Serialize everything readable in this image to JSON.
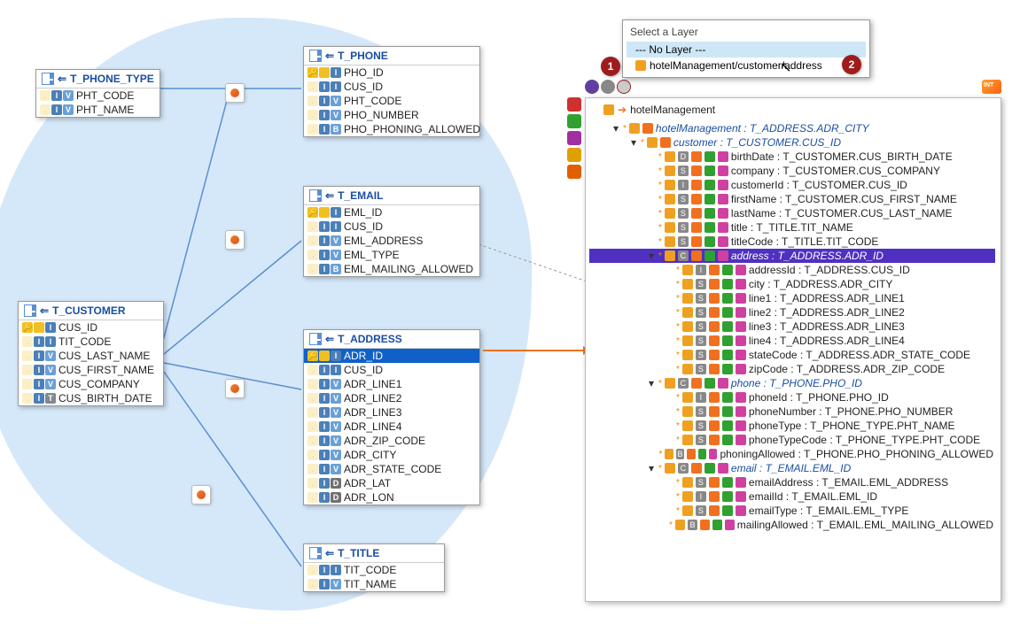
{
  "popup": {
    "title": "Select a Layer",
    "options": [
      "--- No Layer ---",
      "hotelManagement/customer/address"
    ],
    "selected_index": 0
  },
  "callouts": [
    "1",
    "2"
  ],
  "tables": {
    "phone_type": {
      "name": "T_PHONE_TYPE",
      "cols": [
        {
          "t": [
            "i",
            "v"
          ],
          "n": "PHT_CODE"
        },
        {
          "t": [
            "i",
            "v"
          ],
          "n": "PHT_NAME"
        }
      ]
    },
    "phone": {
      "name": "T_PHONE",
      "cols": [
        {
          "t": [
            "k",
            "i"
          ],
          "n": "PHO_ID"
        },
        {
          "t": [
            "i",
            "i"
          ],
          "n": "CUS_ID"
        },
        {
          "t": [
            "i",
            "v"
          ],
          "n": "PHT_CODE"
        },
        {
          "t": [
            "i",
            "v"
          ],
          "n": "PHO_NUMBER"
        },
        {
          "t": [
            "i",
            "b"
          ],
          "n": "PHO_PHONING_ALLOWED"
        }
      ]
    },
    "email": {
      "name": "T_EMAIL",
      "cols": [
        {
          "t": [
            "k",
            "i"
          ],
          "n": "EML_ID"
        },
        {
          "t": [
            "i",
            "i"
          ],
          "n": "CUS_ID"
        },
        {
          "t": [
            "i",
            "v"
          ],
          "n": "EML_ADDRESS"
        },
        {
          "t": [
            "i",
            "v"
          ],
          "n": "EML_TYPE"
        },
        {
          "t": [
            "i",
            "b"
          ],
          "n": "EML_MAILING_ALLOWED"
        }
      ]
    },
    "customer": {
      "name": "T_CUSTOMER",
      "cols": [
        {
          "t": [
            "k",
            "i"
          ],
          "n": "CUS_ID"
        },
        {
          "t": [
            "i",
            "i"
          ],
          "n": "TIT_CODE"
        },
        {
          "t": [
            "i",
            "v"
          ],
          "n": "CUS_LAST_NAME"
        },
        {
          "t": [
            "i",
            "v"
          ],
          "n": "CUS_FIRST_NAME"
        },
        {
          "t": [
            "i",
            "v"
          ],
          "n": "CUS_COMPANY"
        },
        {
          "t": [
            "i",
            "t"
          ],
          "n": "CUS_BIRTH_DATE"
        }
      ]
    },
    "address": {
      "name": "T_ADDRESS",
      "cols": [
        {
          "t": [
            "k",
            "i"
          ],
          "n": "ADR_ID",
          "sel": true
        },
        {
          "t": [
            "i",
            "i"
          ],
          "n": "CUS_ID"
        },
        {
          "t": [
            "i",
            "v"
          ],
          "n": "ADR_LINE1"
        },
        {
          "t": [
            "i",
            "v"
          ],
          "n": "ADR_LINE2"
        },
        {
          "t": [
            "i",
            "v"
          ],
          "n": "ADR_LINE3"
        },
        {
          "t": [
            "i",
            "v"
          ],
          "n": "ADR_LINE4"
        },
        {
          "t": [
            "i",
            "v"
          ],
          "n": "ADR_ZIP_CODE"
        },
        {
          "t": [
            "i",
            "v"
          ],
          "n": "ADR_CITY"
        },
        {
          "t": [
            "i",
            "v"
          ],
          "n": "ADR_STATE_CODE"
        },
        {
          "t": [
            "i",
            "d"
          ],
          "n": "ADR_LAT"
        },
        {
          "t": [
            "i",
            "d"
          ],
          "n": "ADR_LON"
        }
      ]
    },
    "title": {
      "name": "T_TITLE",
      "cols": [
        {
          "t": [
            "i",
            "i"
          ],
          "n": "TIT_CODE"
        },
        {
          "t": [
            "i",
            "v"
          ],
          "n": "TIT_NAME"
        }
      ]
    }
  },
  "tree": {
    "root": "hotelManagement",
    "nodes": [
      {
        "d": 0,
        "tw": "▾",
        "it": true,
        "lbl": "hotelManagement : T_ADDRESS.ADR_CITY"
      },
      {
        "d": 1,
        "tw": "▾",
        "it": true,
        "lbl": "customer : T_CUSTOMER.CUS_ID"
      },
      {
        "d": 2,
        "tw": "",
        "it": false,
        "ic": "D",
        "lbl": "birthDate : T_CUSTOMER.CUS_BIRTH_DATE"
      },
      {
        "d": 2,
        "tw": "",
        "it": false,
        "ic": "S",
        "lbl": "company : T_CUSTOMER.CUS_COMPANY"
      },
      {
        "d": 2,
        "tw": "",
        "it": false,
        "ic": "I",
        "lbl": "customerId : T_CUSTOMER.CUS_ID"
      },
      {
        "d": 2,
        "tw": "",
        "it": false,
        "ic": "S",
        "lbl": "firstName : T_CUSTOMER.CUS_FIRST_NAME"
      },
      {
        "d": 2,
        "tw": "",
        "it": false,
        "ic": "S",
        "lbl": "lastName : T_CUSTOMER.CUS_LAST_NAME"
      },
      {
        "d": 2,
        "tw": "",
        "it": false,
        "ic": "S",
        "lbl": "title : T_TITLE.TIT_NAME"
      },
      {
        "d": 2,
        "tw": "",
        "it": false,
        "ic": "S",
        "lbl": "titleCode : T_TITLE.TIT_CODE"
      },
      {
        "d": 2,
        "tw": "▾",
        "it": true,
        "ic": "C",
        "lbl": "address : T_ADDRESS.ADR_ID",
        "sel": true
      },
      {
        "d": 3,
        "tw": "",
        "it": false,
        "ic": "I",
        "lbl": "addressId : T_ADDRESS.CUS_ID"
      },
      {
        "d": 3,
        "tw": "",
        "it": false,
        "ic": "S",
        "lbl": "city : T_ADDRESS.ADR_CITY"
      },
      {
        "d": 3,
        "tw": "",
        "it": false,
        "ic": "S",
        "lbl": "line1 : T_ADDRESS.ADR_LINE1"
      },
      {
        "d": 3,
        "tw": "",
        "it": false,
        "ic": "S",
        "lbl": "line2 : T_ADDRESS.ADR_LINE2"
      },
      {
        "d": 3,
        "tw": "",
        "it": false,
        "ic": "S",
        "lbl": "line3 : T_ADDRESS.ADR_LINE3"
      },
      {
        "d": 3,
        "tw": "",
        "it": false,
        "ic": "S",
        "lbl": "line4 : T_ADDRESS.ADR_LINE4"
      },
      {
        "d": 3,
        "tw": "",
        "it": false,
        "ic": "S",
        "lbl": "stateCode : T_ADDRESS.ADR_STATE_CODE"
      },
      {
        "d": 3,
        "tw": "",
        "it": false,
        "ic": "S",
        "lbl": "zipCode : T_ADDRESS.ADR_ZIP_CODE"
      },
      {
        "d": 2,
        "tw": "▾",
        "it": true,
        "ic": "C",
        "lbl": "phone : T_PHONE.PHO_ID"
      },
      {
        "d": 3,
        "tw": "",
        "it": false,
        "ic": "I",
        "lbl": "phoneId : T_PHONE.PHO_ID"
      },
      {
        "d": 3,
        "tw": "",
        "it": false,
        "ic": "S",
        "lbl": "phoneNumber : T_PHONE.PHO_NUMBER"
      },
      {
        "d": 3,
        "tw": "",
        "it": false,
        "ic": "S",
        "lbl": "phoneType : T_PHONE_TYPE.PHT_NAME"
      },
      {
        "d": 3,
        "tw": "",
        "it": false,
        "ic": "S",
        "lbl": "phoneTypeCode : T_PHONE_TYPE.PHT_CODE"
      },
      {
        "d": 3,
        "tw": "",
        "it": false,
        "ic": "B",
        "lbl": "phoningAllowed : T_PHONE.PHO_PHONING_ALLOWED"
      },
      {
        "d": 2,
        "tw": "▾",
        "it": true,
        "ic": "C",
        "lbl": "email : T_EMAIL.EML_ID"
      },
      {
        "d": 3,
        "tw": "",
        "it": false,
        "ic": "S",
        "lbl": "emailAddress : T_EMAIL.EML_ADDRESS"
      },
      {
        "d": 3,
        "tw": "",
        "it": false,
        "ic": "I",
        "lbl": "emailId : T_EMAIL.EML_ID"
      },
      {
        "d": 3,
        "tw": "",
        "it": false,
        "ic": "S",
        "lbl": "emailType : T_EMAIL.EML_TYPE"
      },
      {
        "d": 3,
        "tw": "",
        "it": false,
        "ic": "B",
        "lbl": "mailingAllowed : T_EMAIL.EML_MAILING_ALLOWED"
      }
    ]
  }
}
